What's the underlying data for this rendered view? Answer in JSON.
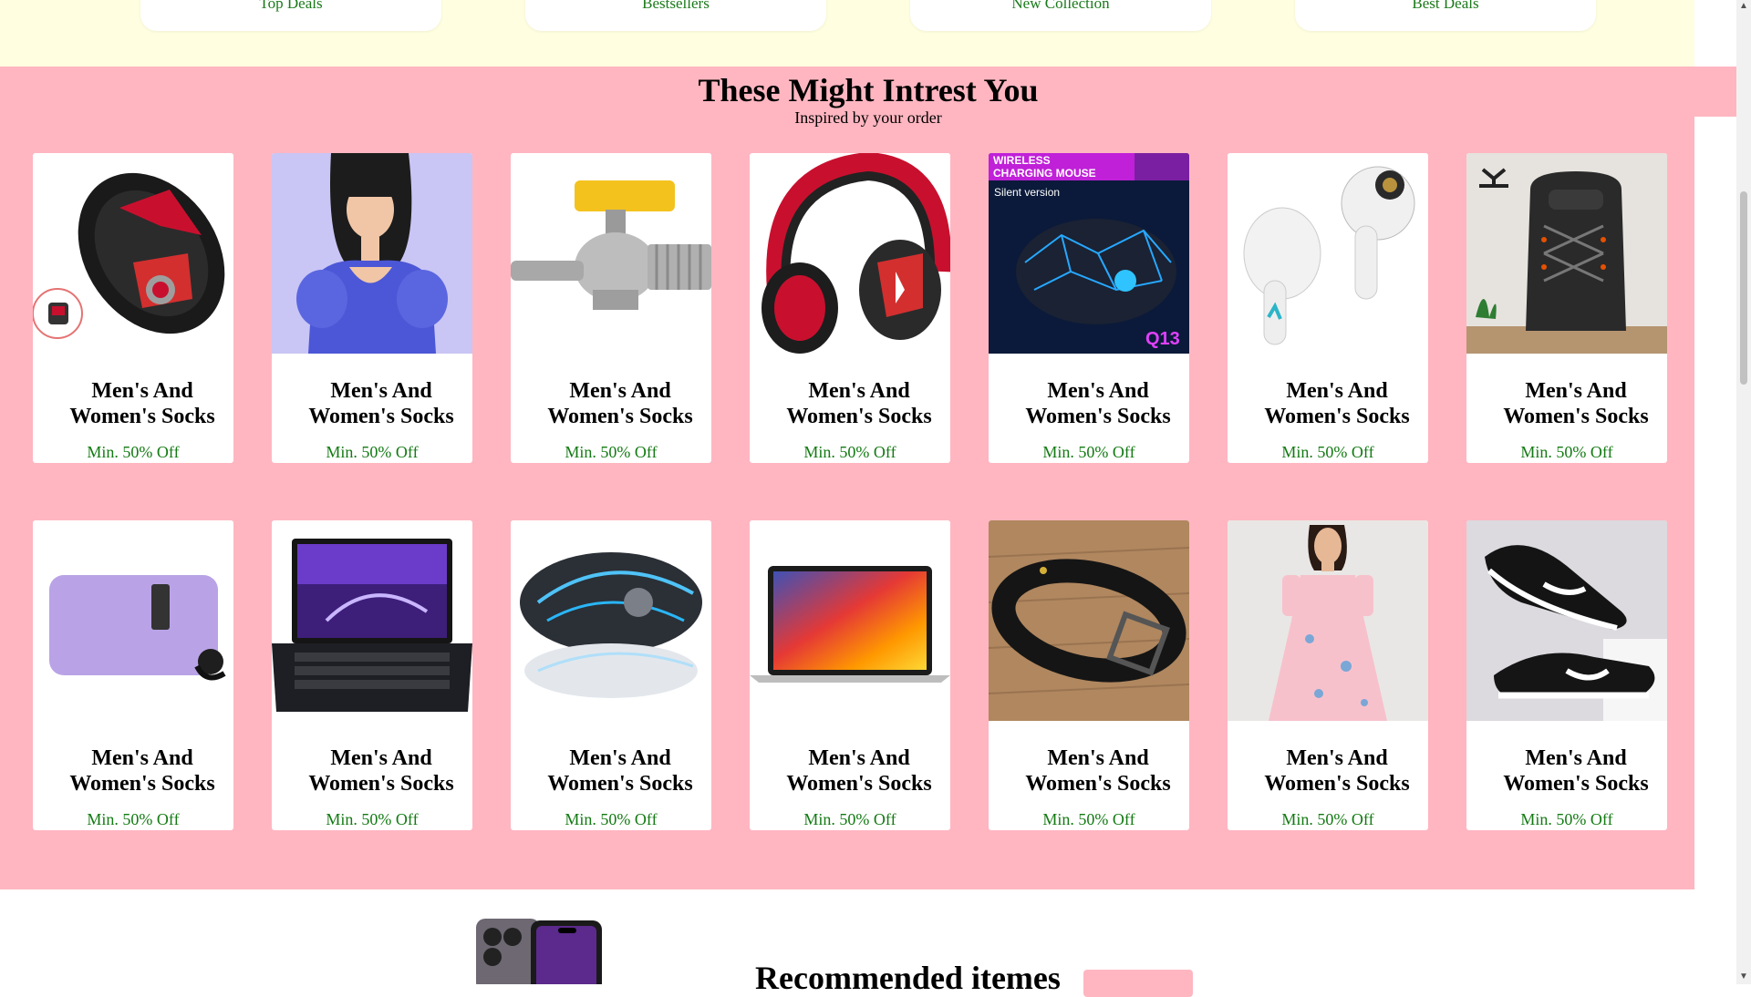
{
  "top_categories": [
    "Top Deals",
    "Bestsellers",
    "New Collection",
    "Best Deals"
  ],
  "section": {
    "title": "These Might Intrest You",
    "subtitle": "Inspired by your order"
  },
  "products": [
    {
      "name": "Men's And Women's Socks",
      "offer": "Min. 50% Off",
      "image": "gaming-mouse-red"
    },
    {
      "name": "Men's And Women's Socks",
      "offer": "Min. 50% Off",
      "image": "woman-blue-top"
    },
    {
      "name": "Men's And Women's Socks",
      "offer": "Min. 50% Off",
      "image": "ball-valve"
    },
    {
      "name": "Men's And Women's Socks",
      "offer": "Min. 50% Off",
      "image": "headphones"
    },
    {
      "name": "Men's And Women's Socks",
      "offer": "Min. 50% Off",
      "image": "wireless-mouse",
      "badge": "WIRELESS CHARGING MOUSE",
      "badge_sub": "Silent version",
      "model": "Q13"
    },
    {
      "name": "Men's And Women's Socks",
      "offer": "Min. 50% Off",
      "image": "earbuds"
    },
    {
      "name": "Men's And Women's Socks",
      "offer": "Min. 50% Off",
      "image": "backpack"
    },
    {
      "name": "Men's And Women's Socks",
      "offer": "Min. 50% Off",
      "image": "lilac-case"
    },
    {
      "name": "Men's And Women's Socks",
      "offer": "Min. 50% Off",
      "image": "gaming-laptop"
    },
    {
      "name": "Men's And Women's Socks",
      "offer": "Min. 50% Off",
      "image": "gaming-mouse-blue"
    },
    {
      "name": "Men's And Women's Socks",
      "offer": "Min. 50% Off",
      "image": "macbook"
    },
    {
      "name": "Men's And Women's Socks",
      "offer": "Min. 50% Off",
      "image": "leather-belt"
    },
    {
      "name": "Men's And Women's Socks",
      "offer": "Min. 50% Off",
      "image": "floral-dress"
    },
    {
      "name": "Men's And Women's Socks",
      "offer": "Min. 50% Off",
      "image": "sneakers"
    }
  ],
  "recommended": {
    "title": "Recommended itemes",
    "button_label": ""
  },
  "colors": {
    "section_bg": "#ffb6c1",
    "top_bg": "#fffee0",
    "offer_text": "#137a13"
  }
}
